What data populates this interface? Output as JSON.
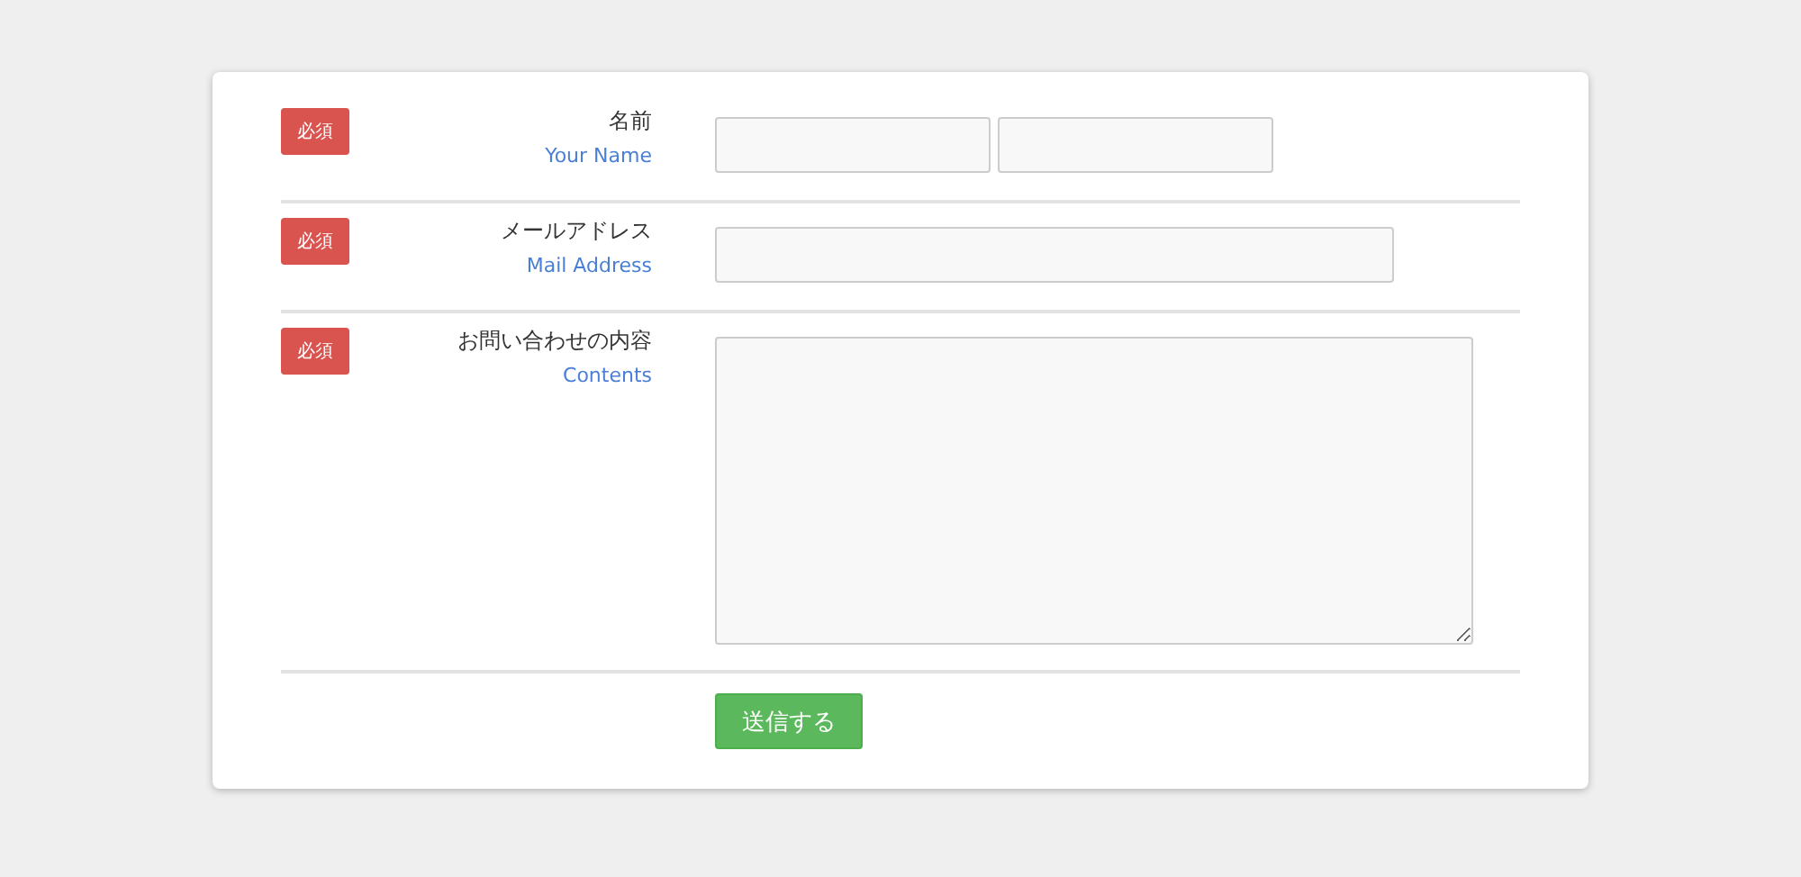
{
  "form": {
    "rows": [
      {
        "kind": "split",
        "badge": "必須",
        "label": "名前",
        "sublabel": "Your Name"
      },
      {
        "kind": "single",
        "badge": "必須",
        "label": "メールアドレス",
        "sublabel": "Mail Address"
      },
      {
        "kind": "textarea",
        "badge": "必須",
        "label": "お問い合わせの内容",
        "sublabel": "Contents"
      }
    ],
    "submit": "送信する"
  }
}
